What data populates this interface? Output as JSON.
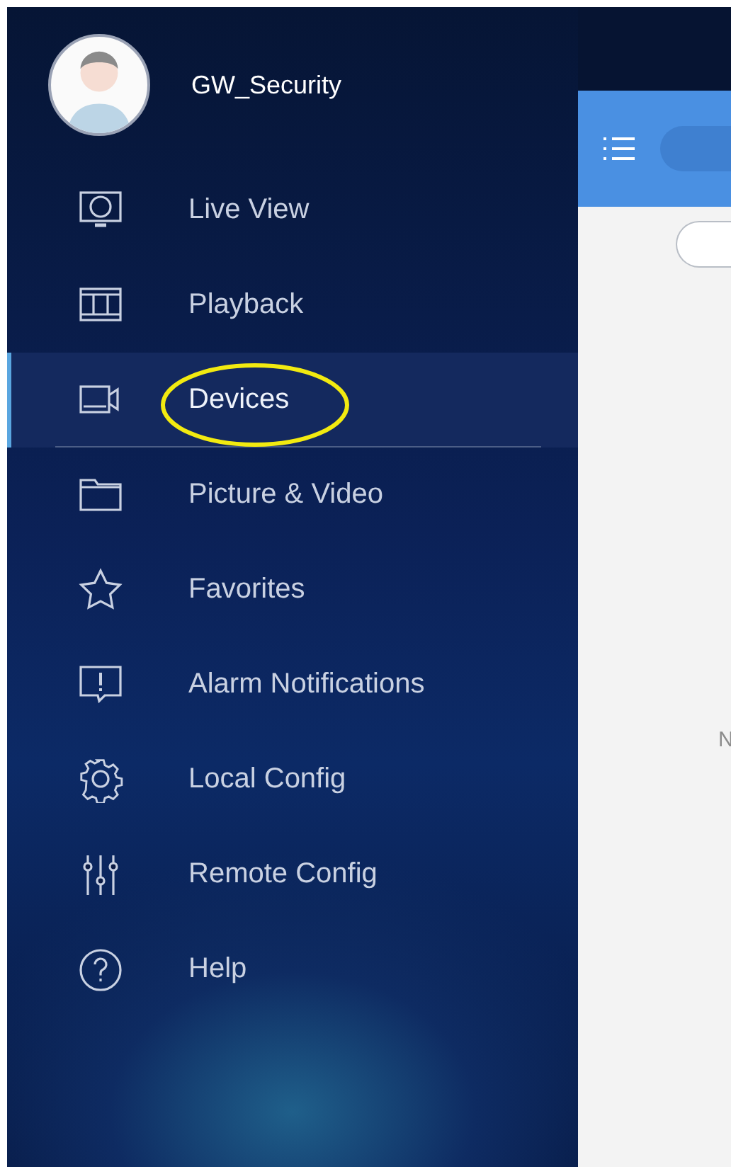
{
  "drawer": {
    "username": "GW_Security",
    "items": [
      {
        "label": "Live View",
        "selected": false
      },
      {
        "label": "Playback",
        "selected": false
      },
      {
        "label": "Devices",
        "selected": true
      },
      {
        "label": "Picture & Video",
        "selected": false
      },
      {
        "label": "Favorites",
        "selected": false
      },
      {
        "label": "Alarm Notifications",
        "selected": false
      },
      {
        "label": "Local Config",
        "selected": false
      },
      {
        "label": "Remote Config",
        "selected": false
      },
      {
        "label": "Help",
        "selected": false
      }
    ]
  },
  "content": {
    "message": "N"
  }
}
